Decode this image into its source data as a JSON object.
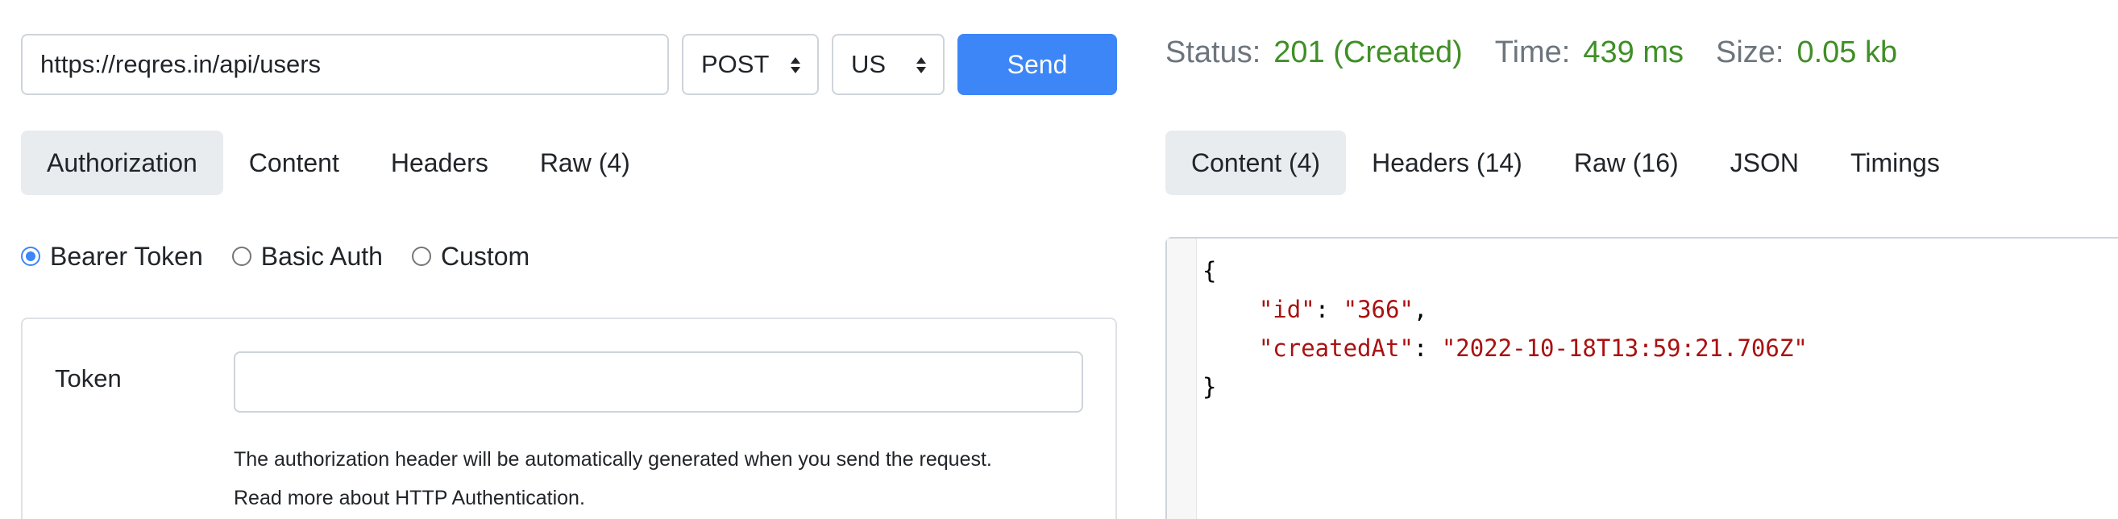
{
  "request": {
    "url": "https://reqres.in/api/users",
    "method": "POST",
    "region": "US",
    "send_label": "Send"
  },
  "request_tabs": [
    {
      "label": "Authorization",
      "active": true
    },
    {
      "label": "Content",
      "active": false
    },
    {
      "label": "Headers",
      "active": false
    },
    {
      "label": "Raw (4)",
      "active": false
    }
  ],
  "auth": {
    "options": [
      {
        "label": "Bearer Token",
        "checked": true
      },
      {
        "label": "Basic Auth",
        "checked": false
      },
      {
        "label": "Custom",
        "checked": false
      }
    ],
    "token_label": "Token",
    "token_value": "",
    "help_line_1": "The authorization header will be automatically generated when you send the request.",
    "help_line_2": "Read more about HTTP Authentication."
  },
  "response": {
    "status_label": "Status:",
    "status_value": "201 (Created)",
    "time_label": "Time:",
    "time_value": "439 ms",
    "size_label": "Size:",
    "size_value": "0.05 kb"
  },
  "response_tabs": [
    {
      "label": "Content (4)",
      "active": true
    },
    {
      "label": "Headers (14)",
      "active": false
    },
    {
      "label": "Raw (16)",
      "active": false
    },
    {
      "label": "JSON",
      "active": false
    },
    {
      "label": "Timings",
      "active": false
    }
  ],
  "response_body": {
    "open_brace": "{",
    "close_brace": "}",
    "fields": [
      {
        "key": "\"id\"",
        "value": "\"366\"",
        "trailing": ","
      },
      {
        "key": "\"createdAt\"",
        "value": "\"2022-10-18T13:59:21.706Z\"",
        "trailing": ""
      }
    ]
  },
  "colors": {
    "accent": "#3d86f7",
    "status_ok": "#3f8f26",
    "muted": "#6c757d",
    "json_string": "#aa1111"
  },
  "icons": {
    "select_caret": "updown-caret-icon"
  }
}
